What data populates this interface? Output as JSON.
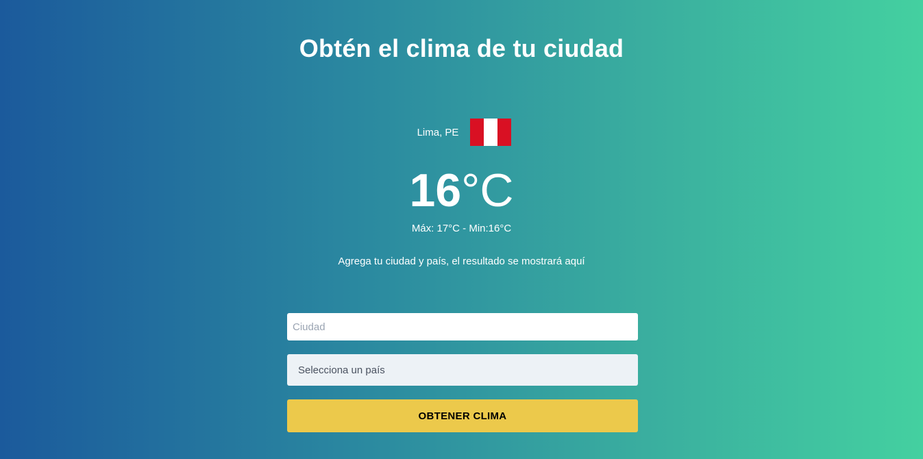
{
  "page": {
    "title": "Obtén el clima de tu ciudad"
  },
  "weather": {
    "location": "Lima, PE",
    "flag_colors": [
      "#d91023",
      "#ffffff",
      "#d91023"
    ],
    "temperature_value": "16",
    "temperature_unit": "°C",
    "minmax": "Máx: 17°C - Min:16°C",
    "hint": "Agrega tu ciudad y país, el resultado se mostrará aquí"
  },
  "form": {
    "city_placeholder": "Ciudad",
    "city_value": "",
    "country_selected": "Selecciona un país",
    "submit_label": "OBTENER CLIMA"
  },
  "colors": {
    "gradient_start": "#1b5a9c",
    "gradient_end": "#44d0a0",
    "button": "#ecc94b",
    "select_bg": "#edf2f6"
  }
}
